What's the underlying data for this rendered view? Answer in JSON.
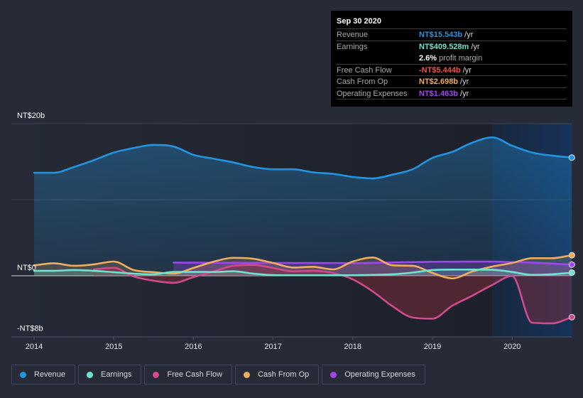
{
  "colors": {
    "revenue": "#2394df",
    "earnings": "#6fe3cf",
    "free_cash_flow": "#d04a8c",
    "cash_from_op": "#f0ae5c",
    "operating_expenses": "#a046ef",
    "fcf_tooltip": "#ff4a4a"
  },
  "tooltip": {
    "date": "Sep 30 2020",
    "rows": [
      {
        "label": "Revenue",
        "value": "NT$15.543b",
        "unit": "/yr"
      },
      {
        "label": "Earnings",
        "value": "NT$409.528m",
        "unit": "/yr"
      },
      {
        "label": "",
        "margin_value": "2.6%",
        "margin_text": "profit margin"
      },
      {
        "label": "Free Cash Flow",
        "value": "-NT$5.444b",
        "unit": "/yr"
      },
      {
        "label": "Cash From Op",
        "value": "NT$2.698b",
        "unit": "/yr"
      },
      {
        "label": "Operating Expenses",
        "value": "NT$1.463b",
        "unit": "/yr"
      }
    ]
  },
  "legend": [
    {
      "key": "revenue",
      "label": "Revenue"
    },
    {
      "key": "earnings",
      "label": "Earnings"
    },
    {
      "key": "free_cash_flow",
      "label": "Free Cash Flow"
    },
    {
      "key": "cash_from_op",
      "label": "Cash From Op"
    },
    {
      "key": "operating_expenses",
      "label": "Operating Expenses"
    }
  ],
  "chart_data": {
    "type": "area",
    "title": "",
    "xlabel": "",
    "ylabel": "",
    "xlim": [
      2013.7,
      2020.75
    ],
    "ylim": [
      -8,
      20
    ],
    "y_ticks": [
      {
        "value": 20,
        "label": "NT$20b"
      },
      {
        "value": 0,
        "label": "NT$0"
      },
      {
        "value": -8,
        "label": "-NT$8b"
      }
    ],
    "gridlines": [
      20,
      10,
      0
    ],
    "x_ticks": [
      {
        "value": 2014,
        "label": "2014"
      },
      {
        "value": 2015,
        "label": "2015"
      },
      {
        "value": 2016,
        "label": "2016"
      },
      {
        "value": 2017,
        "label": "2017"
      },
      {
        "value": 2018,
        "label": "2018"
      },
      {
        "value": 2019,
        "label": "2019"
      },
      {
        "value": 2020,
        "label": "2020"
      }
    ],
    "highlight_range": [
      2019.75,
      2020.75
    ],
    "units": "NT$ billions (trailing 12 months)",
    "x": [
      2014.0,
      2014.25,
      2014.5,
      2014.75,
      2015.0,
      2015.25,
      2015.5,
      2015.75,
      2016.0,
      2016.25,
      2016.5,
      2016.75,
      2017.0,
      2017.25,
      2017.5,
      2017.75,
      2018.0,
      2018.25,
      2018.5,
      2018.75,
      2019.0,
      2019.25,
      2019.5,
      2019.75,
      2020.0,
      2020.25,
      2020.5,
      2020.75
    ],
    "series": [
      {
        "key": "revenue",
        "name": "Revenue",
        "values": [
          13.55,
          13.55,
          14.3,
          15.2,
          16.2,
          16.8,
          17.2,
          17.0,
          15.9,
          15.4,
          14.9,
          14.3,
          14.0,
          14.0,
          13.6,
          13.4,
          13.0,
          12.8,
          13.3,
          14.0,
          15.5,
          16.3,
          17.5,
          18.2,
          17.1,
          16.2,
          15.8,
          15.54
        ]
      },
      {
        "key": "earnings",
        "name": "Earnings",
        "values": [
          0.65,
          0.65,
          0.75,
          0.65,
          0.47,
          0.28,
          0.19,
          0.51,
          0.51,
          0.5,
          0.59,
          0.28,
          0.09,
          0.07,
          0.07,
          0.07,
          0.07,
          0.12,
          0.19,
          0.42,
          0.75,
          0.81,
          0.81,
          0.79,
          0.5,
          0.12,
          0.19,
          0.41
        ]
      },
      {
        "key": "free_cash_flow",
        "name": "Free Cash Flow",
        "values": [
          null,
          null,
          null,
          0.84,
          1.03,
          -0.09,
          -0.65,
          -0.93,
          -0.19,
          0.56,
          1.31,
          1.43,
          1.03,
          0.59,
          0.65,
          0.37,
          -0.47,
          -2.06,
          -4.02,
          -5.49,
          -5.64,
          -3.93,
          -2.62,
          -1.21,
          -0.03,
          -6.17,
          -6.26,
          -5.44
        ]
      },
      {
        "key": "cash_from_op",
        "name": "Cash From Op",
        "values": [
          1.37,
          1.64,
          1.31,
          1.5,
          1.87,
          0.75,
          0.47,
          0.28,
          1.03,
          1.84,
          2.36,
          2.24,
          1.68,
          1.09,
          1.17,
          0.84,
          1.87,
          2.4,
          1.37,
          1.31,
          0.37,
          -0.35,
          0.56,
          1.21,
          1.68,
          2.31,
          2.31,
          2.7
        ]
      },
      {
        "key": "operating_expenses",
        "name": "Operating Expenses",
        "values": [
          null,
          null,
          null,
          null,
          null,
          null,
          null,
          1.73,
          1.72,
          1.71,
          1.7,
          1.7,
          1.69,
          1.68,
          1.68,
          1.67,
          1.65,
          1.7,
          1.75,
          1.8,
          1.84,
          1.85,
          1.86,
          1.86,
          1.8,
          1.73,
          1.6,
          1.46
        ]
      }
    ]
  }
}
